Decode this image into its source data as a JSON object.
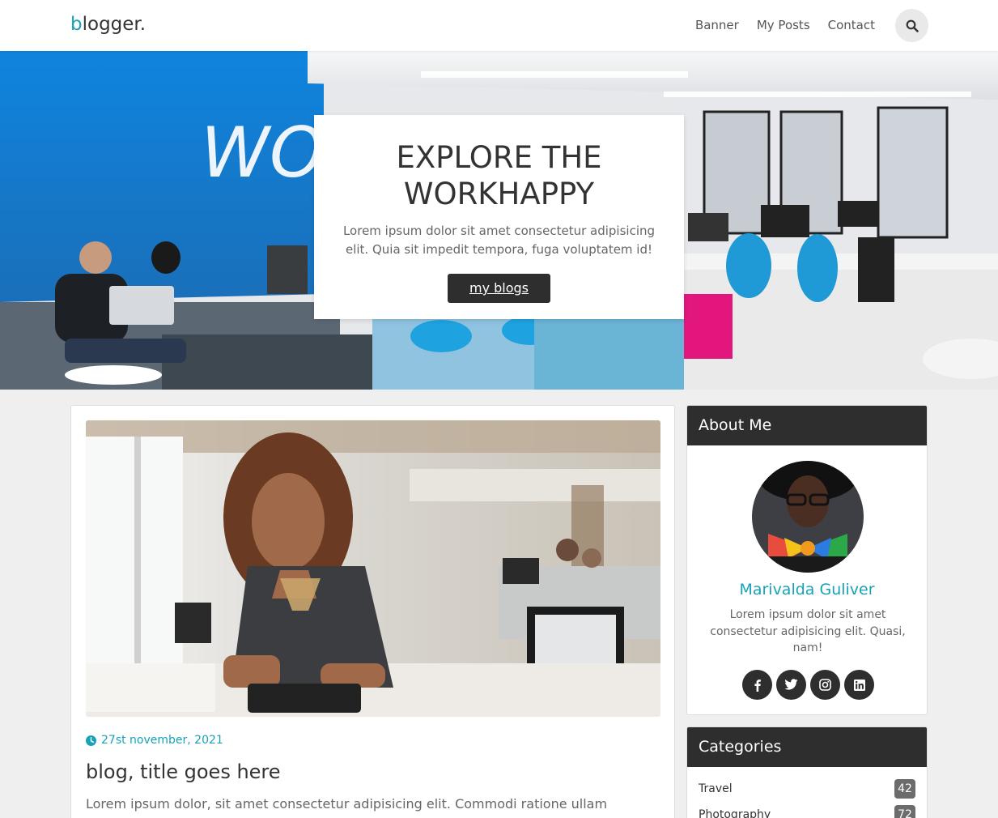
{
  "nav": {
    "brand_first": "b",
    "brand_rest": "logger.",
    "links": [
      "Banner",
      "My Posts",
      "Contact"
    ],
    "search_icon": "search-icon"
  },
  "hero": {
    "wall_text": "WO",
    "title_line1": "EXPLORE THE",
    "title_line2": "WORKHAPPY",
    "text": "Lorem ipsum dolor sit amet consectetur adipisicing elit. Quia sit impedit tempora, fuga voluptatem id!",
    "button": "my blogs"
  },
  "post": {
    "date": "27st november, 2021",
    "date_icon": "clock-icon",
    "title": "blog, title goes here",
    "excerpt": "Lorem ipsum dolor, sit amet consectetur adipisicing elit. Commodi ratione ullam harum"
  },
  "about": {
    "heading": "About Me",
    "name": "Marivalda Guliver",
    "bio": "Lorem ipsum dolor sit amet consectetur adipisicing elit. Quasi, nam!",
    "socials": [
      "facebook-icon",
      "twitter-icon",
      "instagram-icon",
      "linkedin-icon"
    ]
  },
  "categories": {
    "heading": "Categories",
    "items": [
      {
        "name": "Travel",
        "count": "42"
      },
      {
        "name": "Photography",
        "count": "72"
      }
    ]
  },
  "colors": {
    "accent": "#17a2b8",
    "dark": "#2e2e2e",
    "wall_blue": "#1b8fe0"
  }
}
